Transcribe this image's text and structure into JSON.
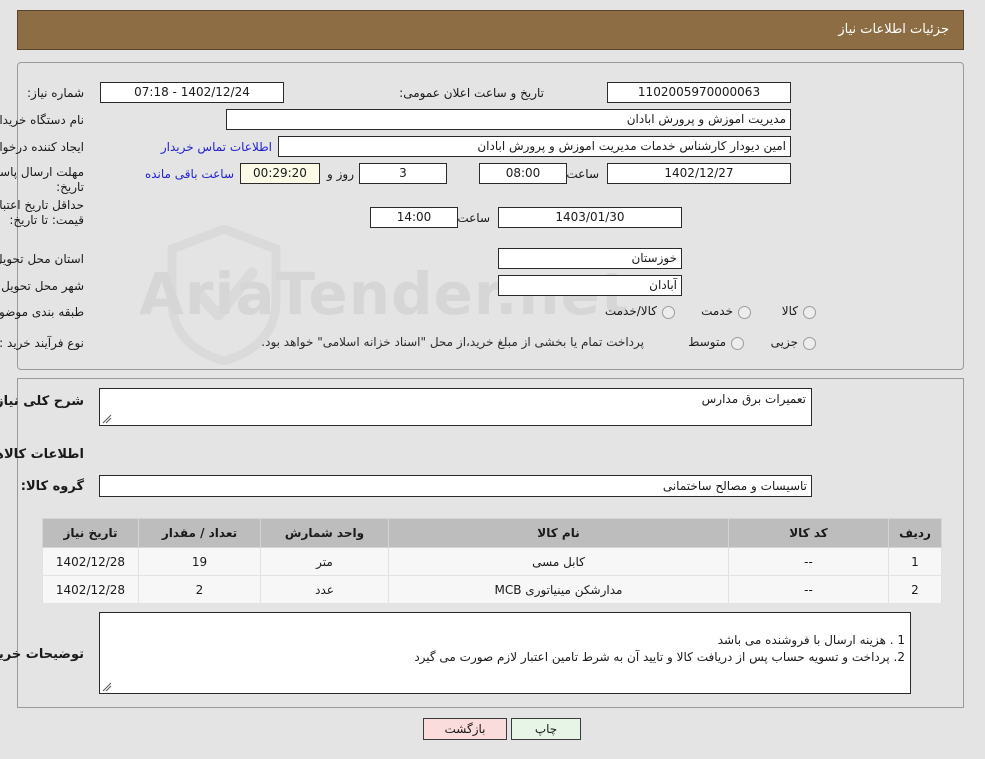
{
  "header": {
    "title": "جزئیات اطلاعات نیاز",
    "bg_color": "#8d6e44"
  },
  "top_section": {
    "need_number_label": "شماره نیاز:",
    "need_number_value": "1102005970000063",
    "public_announce_label": "تاریخ و ساعت اعلان عمومی:",
    "public_announce_value": "1402/12/24 - 07:18",
    "buyer_org_label": "نام دستگاه خریدار:",
    "buyer_org_value": "مدیریت اموزش و پرورش ابادان",
    "requester_label": "ایجاد کننده درخواست:",
    "requester_value": "امین دیودار کارشناس خدمات مدیریت اموزش و پرورش ابادان",
    "contact_link": "اطلاعات تماس خریدار",
    "deadline_label": "مهلت ارسال پاسخ: تا تاریخ:",
    "deadline_date": "1402/12/27",
    "hour_label": "ساعت",
    "deadline_time": "08:00",
    "days_remaining": "3",
    "days_word": "روز و",
    "countdown": "00:29:20",
    "countdown_suffix": "ساعت باقی مانده",
    "price_validity_label": "حداقل تاریخ اعتبار قیمت: تا تاریخ:",
    "price_validity_date": "1403/01/30",
    "price_validity_time": "14:00",
    "province_label": "استان محل تحویل:",
    "province_value": "خوزستان",
    "city_label": "شهر محل تحویل:",
    "city_value": "آبادان",
    "category_label": "طبقه بندی موضوعی:",
    "category_options": [
      "کالا",
      "خدمت",
      "کالا/خدمت"
    ],
    "category_selected": -1,
    "process_label": "نوع فرآیند خرید :",
    "process_options": [
      "جزیی",
      "متوسط"
    ],
    "process_selected": -1,
    "treasury_note": "پرداخت تمام یا بخشی از مبلغ خرید،از محل \"اسناد خزانه اسلامی\" خواهد بود."
  },
  "bottom_section": {
    "general_desc_label": "شرح کلی نیاز:",
    "general_desc_value": "تعمیرات برق مدارس",
    "goods_info_heading": "اطلاعات کالاهای مورد نیاز",
    "goods_group_label": "گروه کالا:",
    "goods_group_value": "تاسیسات و مصالح ساختمانی",
    "buyer_notes_label": "توضیحات خریدار:",
    "buyer_notes_value": "1 . هزینه ارسال با فروشنده می باشد\n2. پرداخت و تسویه حساب پس از دریافت کالا و تایید آن به شرط تامین اعتبار لازم صورت می گیرد"
  },
  "goods_table": {
    "columns": [
      "ردیف",
      "کد کالا",
      "نام کالا",
      "واحد شمارش",
      "تعداد / مقدار",
      "تاریخ نیاز"
    ],
    "rows": [
      {
        "row": "1",
        "code": "--",
        "name": "کابل مسی",
        "unit": "متر",
        "qty": "19",
        "need_date": "1402/12/28"
      },
      {
        "row": "2",
        "code": "--",
        "name": "مدارشکن مینیاتوری MCB",
        "unit": "عدد",
        "qty": "2",
        "need_date": "1402/12/28"
      }
    ]
  },
  "footer": {
    "print_label": "چاپ",
    "back_label": "بازگشت"
  },
  "watermark": {
    "text": "AriaTender.net"
  }
}
